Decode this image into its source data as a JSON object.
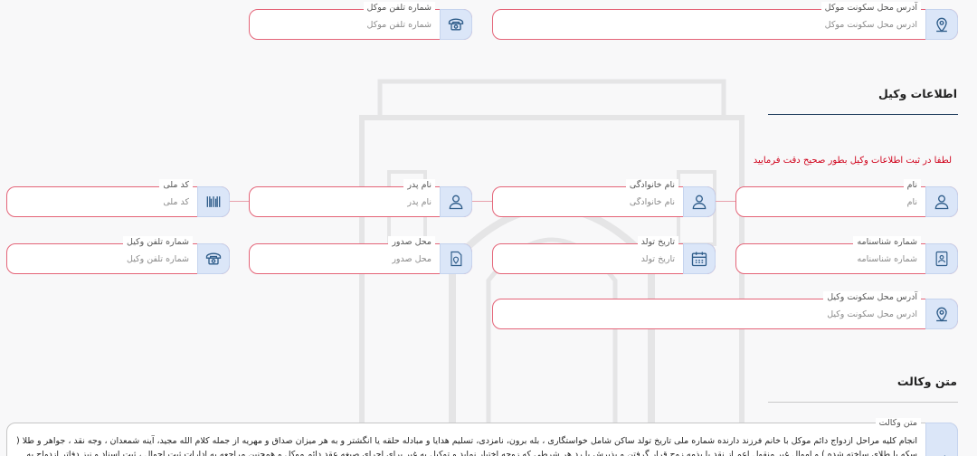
{
  "client": {
    "address": {
      "label": "آدرس محل سکونت موکل",
      "placeholder": "آدرس محل سکونت موکل"
    },
    "phone": {
      "label": "شماره تلفن موکل",
      "placeholder": "شماره تلفن موکل"
    }
  },
  "lawyer_section": {
    "title": "اطلاعات وکیل",
    "warning": "لطفا در ثبت اطلاعات وکیل بطور صحیح دقت فرمایید",
    "first_name": {
      "label": "نام",
      "placeholder": "نام"
    },
    "last_name": {
      "label": "نام خانوادگی",
      "placeholder": "نام خانوادگی"
    },
    "father_name": {
      "label": "نام پدر",
      "placeholder": "نام پدر"
    },
    "national_code": {
      "label": "کد ملی",
      "placeholder": "کد ملی"
    },
    "id_number": {
      "label": "شماره شناسنامه",
      "placeholder": "شماره شناسنامه"
    },
    "birth_date": {
      "label": "تاریخ تولد",
      "placeholder": "تاریخ تولد"
    },
    "issue_place": {
      "label": "محل صدور",
      "placeholder": "محل صدور"
    },
    "phone": {
      "label": "شماره تلفن وکیل",
      "placeholder": "شماره تلفن وکیل"
    },
    "address": {
      "label": "آدرس محل سکونت وکیل",
      "placeholder": "آدرس محل سکونت وکیل"
    }
  },
  "power_text_section": {
    "title": "متن وکالت",
    "field_label": "متن وکالت",
    "text": "انجام کلیه مراحل ازدواج دائم موکل با خانم     فرزند     دارنده شماره ملی     تاریخ تولد     ساکن  شامل خواستگاری ، بله برون، نامزدی، تسلیم هدایا و مبادله حلقه یا انگشتر و به هر میزان صداق و مهریه از جمله کلام الله مجید، آینه شمعدان ، وجه نقد ، جواهر و طلا ( سکه یا طلای ساخته شده ) و اموال غیر منقول اعم از نقد یا بذمه زوج قرار گرفتن و پذیرش با رد هر شرطی که زوجه اختیار نماید و توکیل به غیر برای اجرای صیغه عقد دائم موکل و همچنین مراجعه به ادارات ثبت احوال ، ثبت اسناد و نیز دفاتر ازدواج به"
  },
  "colors": {
    "field_border": "#e46478",
    "icon_bg": "#dbe6f8",
    "icon_color": "#2f5d8a",
    "warning": "#d0021b"
  }
}
